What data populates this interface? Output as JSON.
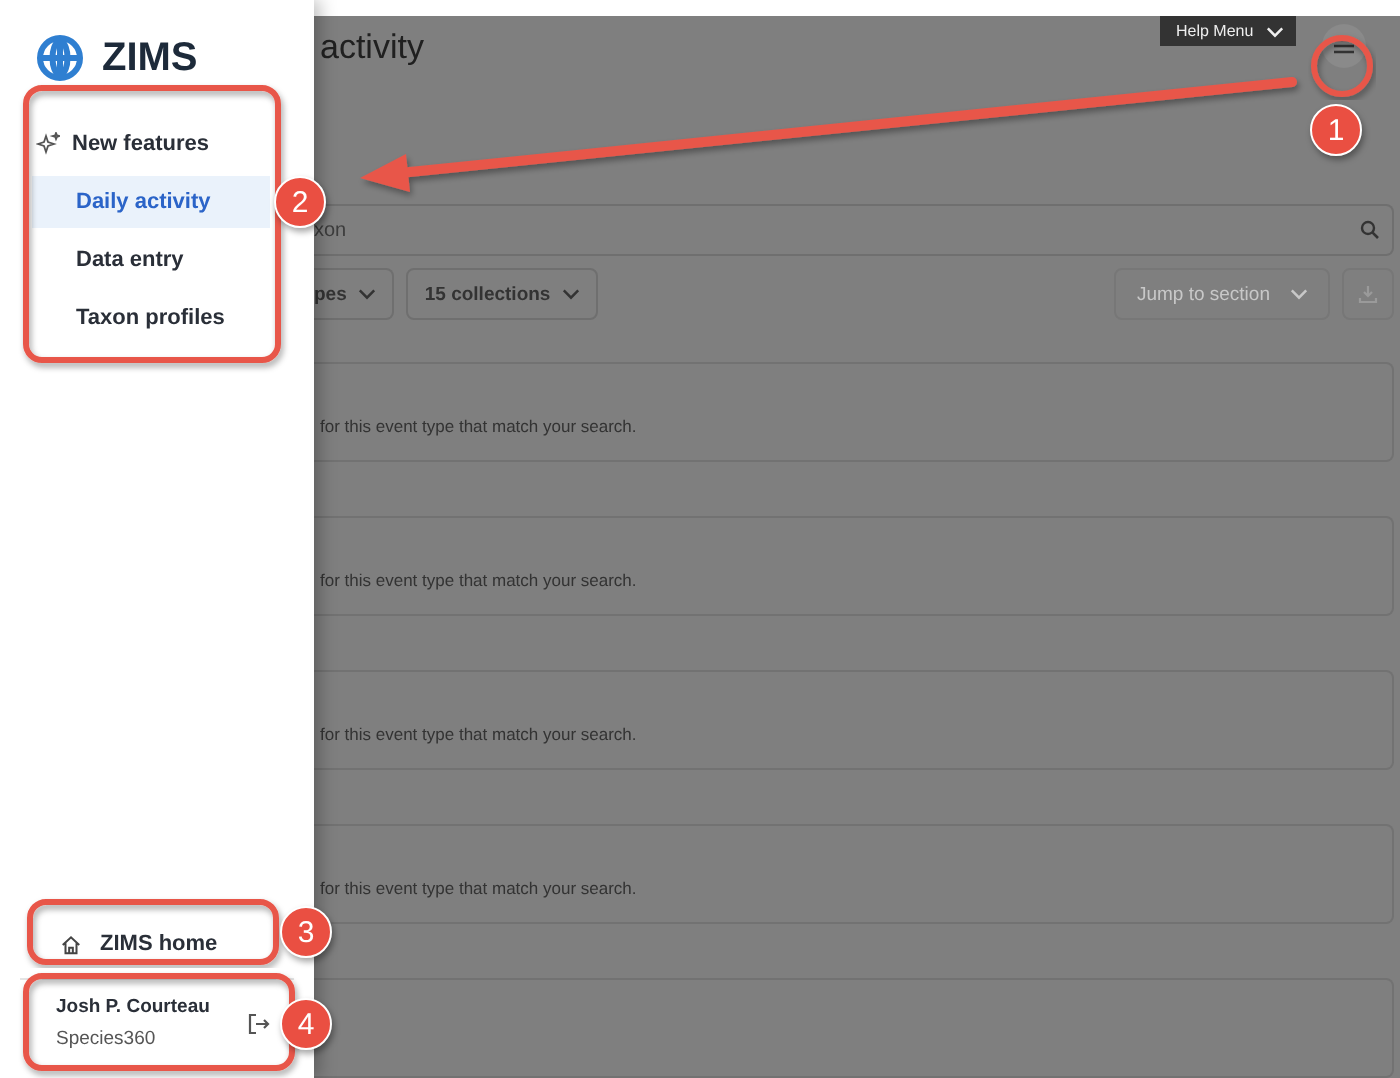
{
  "sidebar": {
    "brand": "ZIMS",
    "items": [
      {
        "label": "New features",
        "kind": "feature",
        "selected": false
      },
      {
        "label": "Daily activity",
        "kind": "link",
        "selected": true
      },
      {
        "label": "Data entry",
        "kind": "link",
        "selected": false
      },
      {
        "label": "Taxon profiles",
        "kind": "link",
        "selected": false
      }
    ],
    "home": "ZIMS home",
    "user": {
      "name": "Josh P. Courteau",
      "org": "Species360"
    }
  },
  "main": {
    "title": "activity",
    "help_menu": "Help Menu",
    "search": {
      "placeholder": "xon"
    },
    "filters": [
      "pes",
      "15 collections"
    ],
    "jump": "Jump to section",
    "cards": [
      {
        "kind": "message",
        "message": "for this event type that match your search."
      },
      {
        "kind": "message",
        "message": "for this event type that match your search."
      },
      {
        "kind": "message",
        "message": "for this event type that match your search."
      },
      {
        "kind": "message",
        "message": "for this event type that match your search."
      },
      {
        "kind": "blank"
      }
    ]
  },
  "callouts": [
    "1",
    "2",
    "3",
    "4"
  ]
}
